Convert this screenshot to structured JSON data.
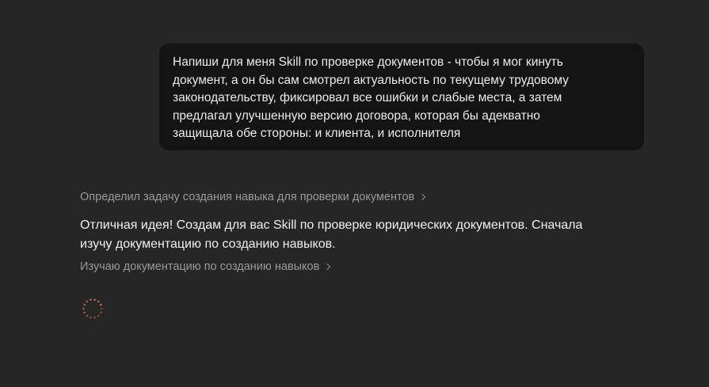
{
  "conversation": {
    "user_message": "Напиши для меня Skill по проверке документов - чтобы я мог кинуть\nдокумент, а он бы сам смотрел актуальность по текущему трудовому\nзаконодательству, фиксировал все ошибки и слабые места, а затем\nпредлагал улучшенную версию договора, которая бы адекватно\nзащищала обе стороны: и клиента, и исполнителя",
    "steps": [
      {
        "label": "Определил задачу создания навыка для проверки документов"
      },
      {
        "label": "Изучаю документацию по созданию навыков"
      }
    ],
    "assistant_message": "Отличная идея! Создам для вас Skill по проверке юридических документов. Сначала\nизучу документацию по созданию навыков."
  },
  "colors": {
    "background": "#262626",
    "user_bubble": "#141414",
    "spinner_accent": "#d97757"
  },
  "icons": {
    "step_chevron": "chevron-right-icon",
    "loading": "loading-spinner-icon"
  }
}
